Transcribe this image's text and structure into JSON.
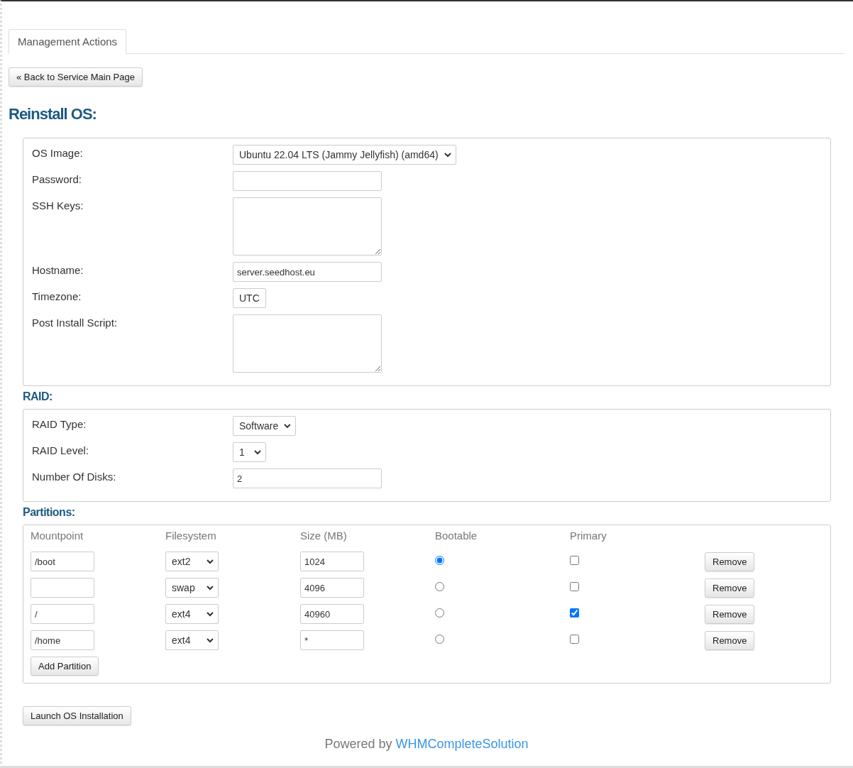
{
  "tabs": [
    {
      "label": "Management Actions",
      "selected": true
    }
  ],
  "back_button": "« Back to Service Main Page",
  "heading": "Reinstall OS:",
  "os_fields": [
    {
      "kind": "select",
      "label": "OS Image:",
      "value": "Ubuntu 22.04 LTS (Jammy Jellyfish) (amd64)"
    },
    {
      "kind": "input",
      "label": "Password:"
    },
    {
      "kind": "textarea",
      "label": "SSH Keys:"
    },
    {
      "kind": "input",
      "label": "Hostname:",
      "value": "server.seedhost.eu"
    },
    {
      "kind": "select",
      "label": "Timezone:",
      "value": "UTC"
    },
    {
      "kind": "textarea",
      "label": "Post Install Script:"
    }
  ],
  "raid": {
    "title": "RAID:",
    "fields": [
      {
        "kind": "select",
        "label": "RAID Type:",
        "value": "Software"
      },
      {
        "kind": "select",
        "label": "RAID Level:",
        "value": "1"
      },
      {
        "kind": "input",
        "label": "Number Of Disks:",
        "value": "2"
      }
    ]
  },
  "partitions": {
    "title": "Partitions:",
    "columns": [
      "Mountpoint",
      "Filesystem",
      "Size (MB)",
      "Bootable",
      "Primary"
    ],
    "rows": [
      {
        "mountpoint": "/boot",
        "filesystem": "ext2",
        "size": "1024",
        "bootable": true,
        "primary": false,
        "remove": "Remove"
      },
      {
        "mountpoint": "",
        "filesystem": "swap",
        "size": "4096",
        "bootable": false,
        "primary": false,
        "remove": "Remove"
      },
      {
        "mountpoint": "/",
        "filesystem": "ext4",
        "size": "40960",
        "bootable": false,
        "primary": true,
        "remove": "Remove"
      },
      {
        "mountpoint": "/home",
        "filesystem": "ext4",
        "size": "*",
        "bootable": false,
        "primary": false,
        "remove": "Remove"
      }
    ],
    "add_button": "Add Partition"
  },
  "launch_button": "Launch OS Installation",
  "footer": {
    "text": "Powered by",
    "link": "WHMCompleteSolution"
  }
}
